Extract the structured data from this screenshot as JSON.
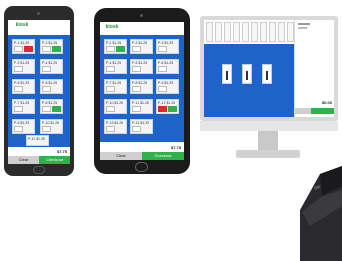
{
  "brand": {
    "logo_text": "kiosk",
    "accent": "#1e64c8",
    "checkout_color": "#2fb24a",
    "remove_color": "#d82c2c"
  },
  "phone": {
    "items": [
      {
        "label": "P-1  $1.25"
      },
      {
        "label": "P-2  $1.25"
      },
      {
        "label": "P-3  $1.25"
      },
      {
        "label": "P-4  $1.25"
      },
      {
        "label": "P-5  $1.25"
      },
      {
        "label": "P-6  $1.25"
      },
      {
        "label": "P-7  $1.25"
      },
      {
        "label": "P-8  $1.25"
      },
      {
        "label": "P-9  $1.25"
      },
      {
        "label": "P-10 $1.25"
      },
      {
        "label": "P-11 $1.25"
      }
    ],
    "total": "$7.75",
    "clear_label": "Clear",
    "checkout_label": "Checkout"
  },
  "tablet": {
    "items": [
      {
        "label": "P-1  $1.25"
      },
      {
        "label": "P-2  $1.25"
      },
      {
        "label": "P-3  $1.25"
      },
      {
        "label": "P-4  $1.25"
      },
      {
        "label": "P-5  $1.25"
      },
      {
        "label": "P-6  $1.25"
      },
      {
        "label": "P-7  $1.25"
      },
      {
        "label": "P-8  $1.25"
      },
      {
        "label": "P-9  $1.25"
      },
      {
        "label": "P-10 $1.25"
      },
      {
        "label": "P-11 $1.25"
      },
      {
        "label": "P-12 $1.25"
      },
      {
        "label": "P-13 $1.25"
      },
      {
        "label": "P-14 $1.25"
      }
    ],
    "total": "$7.75",
    "clear_label": "Clear",
    "checkout_label": "Checkout"
  },
  "monitor": {
    "total": "$0.00"
  }
}
